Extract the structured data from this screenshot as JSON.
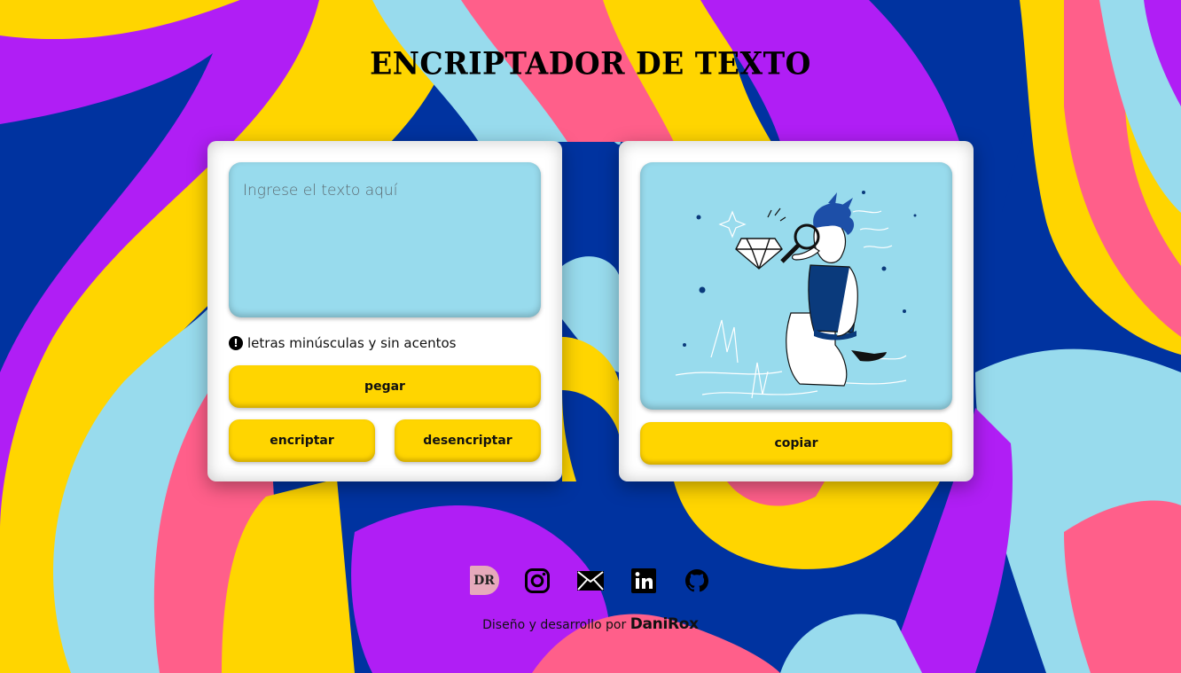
{
  "header": {
    "title": "ENCRIPTADOR DE TEXTO"
  },
  "input_card": {
    "placeholder": "Ingrese el texto aquí",
    "value": "",
    "hint_icon": "exclamation-circle-icon",
    "hint": "letras minúsculas y sin acentos",
    "paste_label": "pegar",
    "encrypt_label": "encriptar",
    "decrypt_label": "desencriptar"
  },
  "output_card": {
    "illustration": "person-magnifying-glass-diamond-illustration",
    "copy_label": "copiar"
  },
  "social": [
    {
      "name": "DaniRox logo",
      "icon": "dr-logo-icon",
      "text": "DR"
    },
    {
      "name": "Instagram",
      "icon": "instagram-icon"
    },
    {
      "name": "Email",
      "icon": "email-icon"
    },
    {
      "name": "LinkedIn",
      "icon": "linkedin-icon"
    },
    {
      "name": "GitHub",
      "icon": "github-icon"
    }
  ],
  "footer": {
    "prefix": "Diseño y desarrollo por",
    "brand": "DaniRox"
  },
  "colors": {
    "yellow": "#ffd500",
    "light_blue": "#98dbed",
    "dark_blue": "#0033a0",
    "purple": "#b01ef5",
    "pink": "#ff5f8a"
  }
}
